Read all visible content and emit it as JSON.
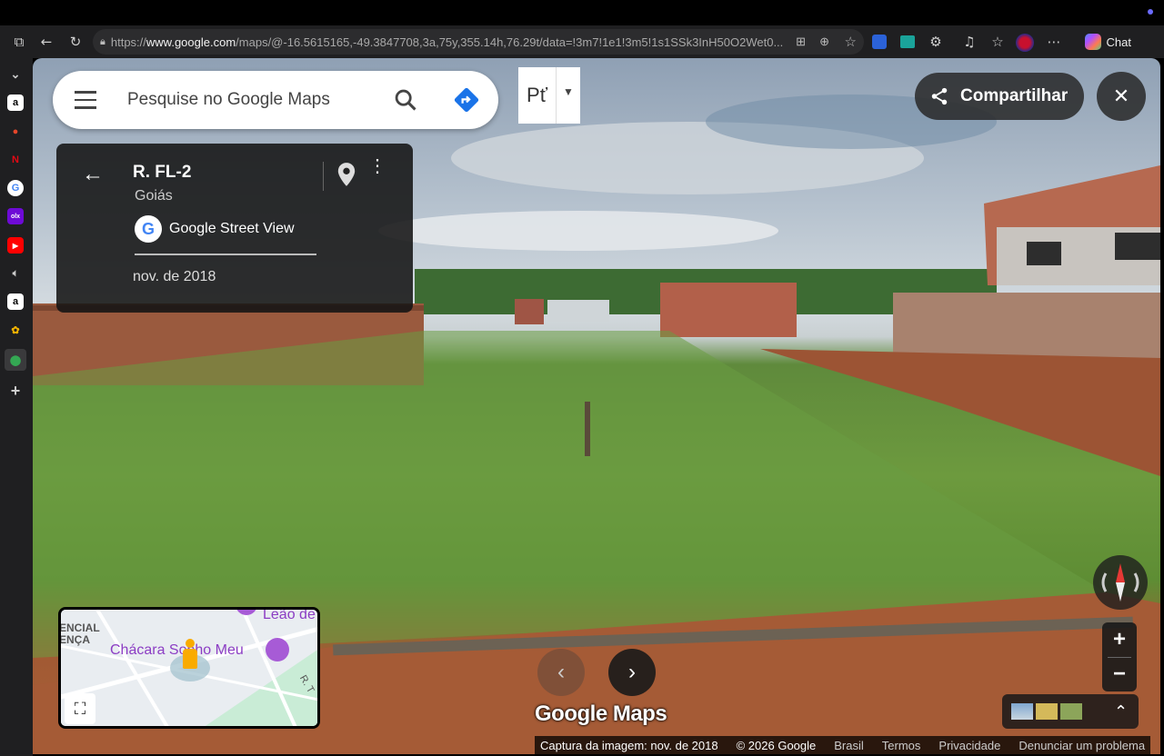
{
  "browser": {
    "url_prefix": "https://",
    "url_domain": "www.google.com",
    "url_rest": "/maps/@-16.5615165,-49.3847708,3a,75y,355.14h,76.29t/data=!3m7!1e1!3m5!1s1SSk3InH50O2Wet0...",
    "chat_label": "Chat"
  },
  "search": {
    "placeholder": "Pesquise no Google Maps"
  },
  "layer_button": {
    "label": "Pť"
  },
  "share": {
    "label": "Compartilhar"
  },
  "place": {
    "title": "R. FL-2",
    "region": "Goiás",
    "provider": "Google Street View",
    "capture_date": "nov. de 2018"
  },
  "minimap": {
    "label_top_left_1": "ENCIAL",
    "label_top_left_2": "ENÇA",
    "label_chacara": "Chácara Sonho Meu",
    "label_leao": "Leão de",
    "label_road": "R. T"
  },
  "wordmark": "Google Maps",
  "footer": {
    "capture": "Captura da imagem: nov. de 2018",
    "copyright": "© 2026 Google",
    "country": "Brasil",
    "terms": "Termos",
    "privacy": "Privacidade",
    "report": "Denunciar um problema"
  },
  "colors": {
    "accent_directions": "#1a73e8",
    "panel_dark": "#141414",
    "minimap_place": "#8c3dc4"
  }
}
